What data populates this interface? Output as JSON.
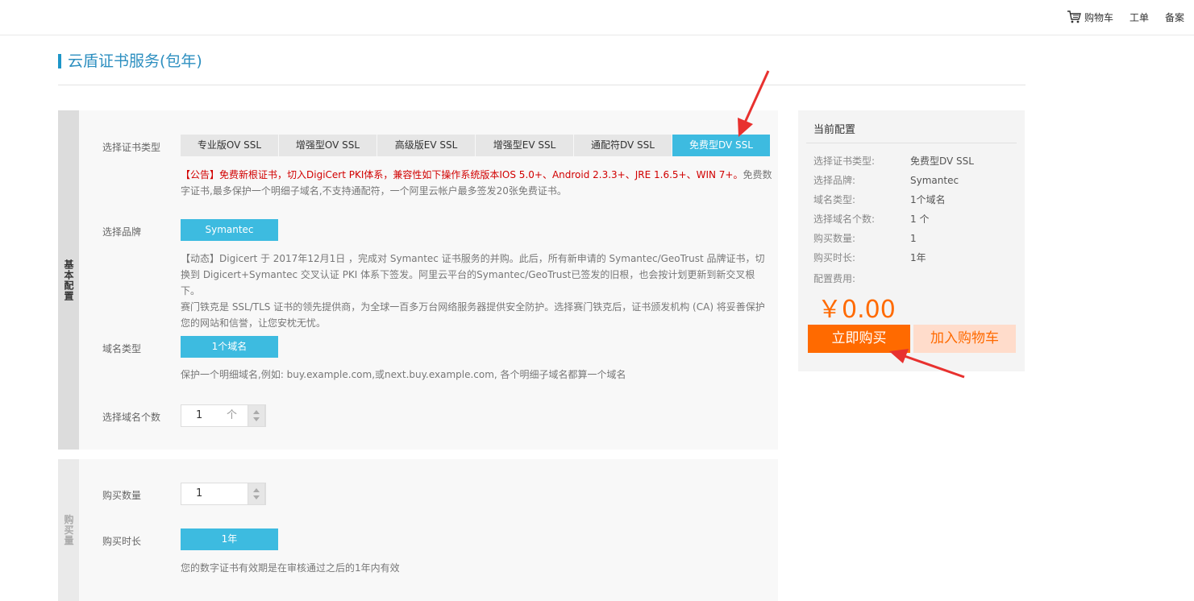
{
  "topnav": {
    "cart_label": "购物车",
    "ticket_label": "工单",
    "record_label": "备案"
  },
  "page": {
    "title": "云盾证书服务(包年)"
  },
  "basic": {
    "side_label": "基本配置",
    "cert_type_label": "选择证书类型",
    "cert_tabs": [
      {
        "label": "专业版OV SSL",
        "active": false
      },
      {
        "label": "增强型OV SSL",
        "active": false
      },
      {
        "label": "高级版EV SSL",
        "active": false
      },
      {
        "label": "增强型EV SSL",
        "active": false
      },
      {
        "label": "通配符DV SSL",
        "active": false
      },
      {
        "label": "免费型DV SSL",
        "active": true
      }
    ],
    "notice_red": "【公告】免费新根证书，切入DigiCert PKI体系，兼容性如下操作系统版本IOS 5.0+、Android 2.3.3+、JRE 1.6.5+、WIN 7+。",
    "notice_rest": "免费数字证书,最多保护一个明细子域名,不支持通配符，一个阿里云帐户最多签发20张免费证书。",
    "brand_label": "选择品牌",
    "brand_value": "Symantec",
    "brand_desc_1": "【动态】Digicert 于 2017年12月1日 ，完成对 Symantec 证书服务的并购。此后，所有新申请的 Symantec/GeoTrust 品牌证书，切换到 Digicert+Symantec 交叉认证 PKI 体系下签发。阿里云平台的Symantec/GeoTrust已签发的旧根，也会按计划更新到新交叉根下。",
    "brand_desc_2": "赛门铁克是 SSL/TLS 证书的领先提供商，为全球一百多万台网络服务器提供安全防护。选择赛门铁克后，证书颁发机构 (CA) 将妥善保护您的网站和信誉，让您安枕无忧。",
    "domain_type_label": "域名类型",
    "domain_type_value": "1个域名",
    "domain_type_desc": "保护一个明细域名,例如: buy.example.com,或next.buy.example.com, 各个明细子域名都算一个域名",
    "domain_count_label": "选择域名个数",
    "domain_count_value": "1",
    "domain_count_unit": "个"
  },
  "qty": {
    "side_label": "购买量",
    "quantity_label": "购买数量",
    "quantity_value": "1",
    "duration_label": "购买时长",
    "duration_value": "1年",
    "duration_desc": "您的数字证书有效期是在审核通过之后的1年内有效"
  },
  "summary": {
    "title": "当前配置",
    "rows": [
      {
        "key": "选择证书类型:",
        "value": "免费型DV SSL"
      },
      {
        "key": "选择品牌:",
        "value": "Symantec"
      },
      {
        "key": "域名类型:",
        "value": "1个域名"
      },
      {
        "key": "选择域名个数:",
        "value": "1 个"
      },
      {
        "key": "购买数量:",
        "value": "1"
      },
      {
        "key": "购买时长:",
        "value": "1年"
      }
    ],
    "fee_label": "配置费用:",
    "price": "￥0.00",
    "buy_label": "立即购买",
    "add_cart_label": "加入购物车"
  },
  "colors": {
    "accent_blue": "#3dbbe0",
    "title_blue": "#2d8fc0",
    "orange": "#ff6a00",
    "notice_red": "#d10000",
    "arrow_red": "#e8312f"
  }
}
